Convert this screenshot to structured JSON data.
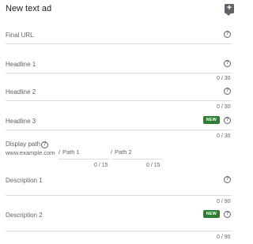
{
  "header": {
    "title": "New text ad",
    "preview_icon": "comment-add-icon"
  },
  "fields": {
    "final_url": {
      "label": "Final URL"
    },
    "headline1": {
      "label": "Headline 1",
      "counter": "0 / 30"
    },
    "headline2": {
      "label": "Headline 2",
      "counter": "0 / 30"
    },
    "headline3": {
      "label": "Headline 3",
      "badge": "NEW",
      "counter": "0 / 30"
    },
    "display_path": {
      "label": "Display path",
      "domain": "www.example.com",
      "path1": {
        "prefix": "/",
        "placeholder": "Path 1",
        "counter": "0 / 15"
      },
      "path2": {
        "prefix": "/",
        "placeholder": "Path 2",
        "counter": "0 / 15"
      }
    },
    "description1": {
      "label": "Description 1",
      "counter": "0 / 90"
    },
    "description2": {
      "label": "Description 2",
      "badge": "NEW",
      "counter": "0 / 90"
    }
  },
  "icons": {
    "help": "?"
  },
  "colors": {
    "badge": "#2e7d32",
    "divider": "#dadce0",
    "text": "#5f6368"
  }
}
